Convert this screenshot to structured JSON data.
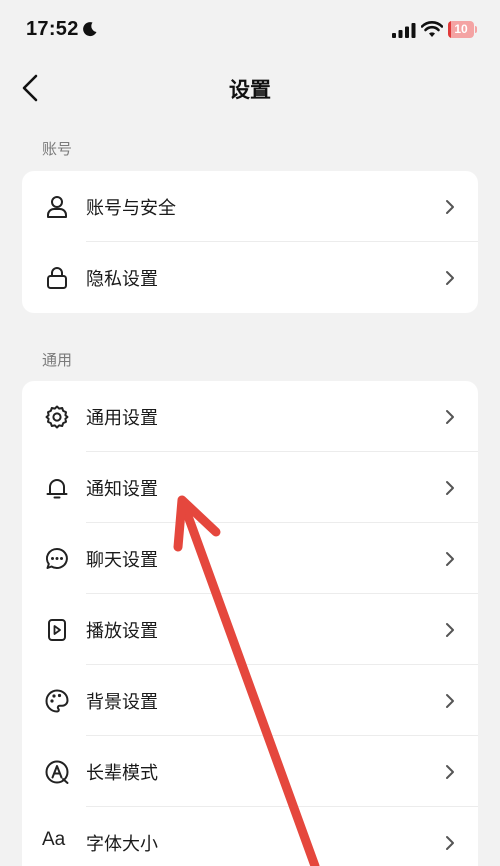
{
  "status_bar": {
    "time": "17:52",
    "battery_level": "10",
    "battery_fraction": 0.1,
    "icons": [
      "moon-icon",
      "signal-icon",
      "wifi-icon",
      "battery-icon"
    ]
  },
  "nav": {
    "title": "设置",
    "back_icon": "chevron-left-icon"
  },
  "sections": [
    {
      "label": "账号",
      "items": [
        {
          "icon": "user-icon",
          "label": "账号与安全"
        },
        {
          "icon": "lock-icon",
          "label": "隐私设置"
        }
      ]
    },
    {
      "label": "通用",
      "items": [
        {
          "icon": "gear-icon",
          "label": "通用设置"
        },
        {
          "icon": "bell-icon",
          "label": "通知设置"
        },
        {
          "icon": "chat-bubble-icon",
          "label": "聊天设置"
        },
        {
          "icon": "play-icon",
          "label": "播放设置"
        },
        {
          "icon": "palette-icon",
          "label": "背景设置"
        },
        {
          "icon": "elder-mode-icon",
          "label": "长辈模式"
        },
        {
          "icon": "font-size-icon",
          "icon_text": "Aa",
          "label": "字体大小"
        }
      ]
    }
  ],
  "colors": {
    "background": "#f2f2f2",
    "card": "#ffffff",
    "section_label": "#7b7b7b",
    "annotation_arrow": "#e5473d",
    "battery_low": "#e03a3a"
  }
}
